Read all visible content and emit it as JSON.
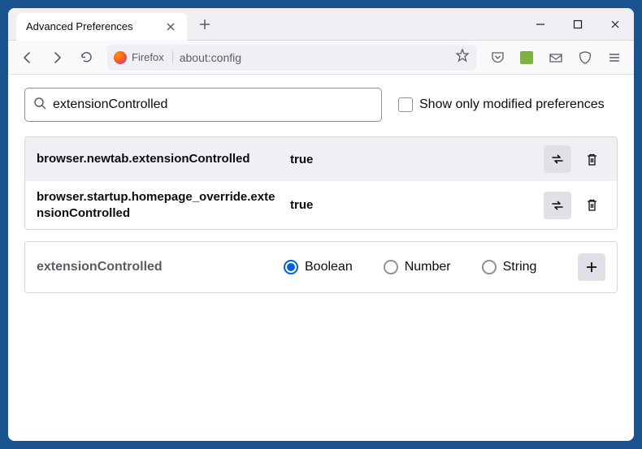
{
  "tab": {
    "title": "Advanced Preferences"
  },
  "urlbar": {
    "identity": "Firefox",
    "url": "about:config"
  },
  "search": {
    "value": "extensionControlled"
  },
  "filter": {
    "show_modified_label": "Show only modified preferences"
  },
  "prefs": [
    {
      "name": "browser.newtab.extensionControlled",
      "value": "true"
    },
    {
      "name": "browser.startup.homepage_override.extensionControlled",
      "value": "true"
    }
  ],
  "add_row": {
    "name": "extensionControlled",
    "options": {
      "boolean": "Boolean",
      "number": "Number",
      "string": "String"
    }
  }
}
